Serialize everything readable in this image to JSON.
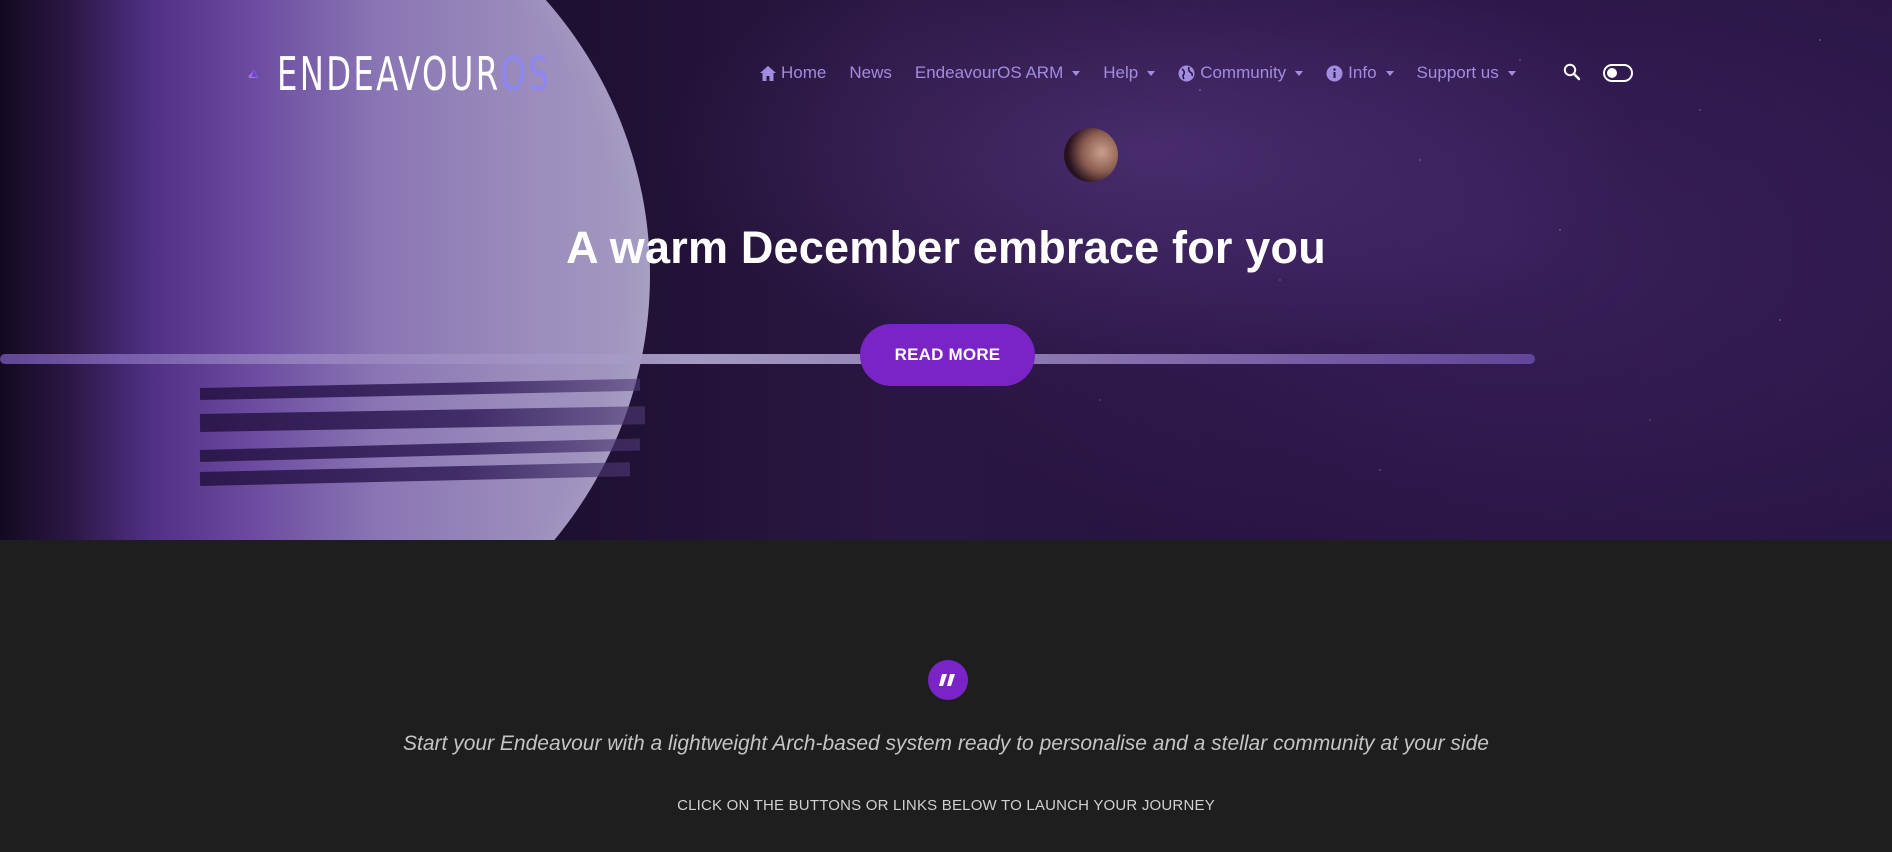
{
  "brand": {
    "name_main": "ENDEAVOUR",
    "name_suffix": "OS",
    "logo_icon": "endeavouros-triangle-logo"
  },
  "nav": {
    "items": [
      {
        "label": "Home",
        "icon": "home-icon",
        "has_dropdown": false
      },
      {
        "label": "News",
        "icon": null,
        "has_dropdown": false
      },
      {
        "label": "EndeavourOS ARM",
        "icon": null,
        "has_dropdown": true
      },
      {
        "label": "Help",
        "icon": null,
        "has_dropdown": true
      },
      {
        "label": "Community",
        "icon": "globe-icon",
        "has_dropdown": true
      },
      {
        "label": "Info",
        "icon": "info-icon",
        "has_dropdown": true
      },
      {
        "label": "Support us",
        "icon": null,
        "has_dropdown": true
      }
    ],
    "search_icon": "search-icon",
    "theme_toggle": {
      "state": "off"
    }
  },
  "hero": {
    "title": "A warm December embrace for you",
    "button_label": "READ MORE"
  },
  "intro": {
    "quote_icon": "quote-icon",
    "tagline": "Start your Endeavour with a lightweight Arch-based system ready to personalise and a stellar community at your side",
    "subtagline": "CLICK ON THE BUTTONS OR LINKS BELOW TO LAUNCH YOUR JOURNEY"
  },
  "colors": {
    "accent": "#7a24c8",
    "nav_text": "#a18ce0",
    "logo_os": "#8f86f5",
    "section_bg": "#1e1e1e"
  }
}
